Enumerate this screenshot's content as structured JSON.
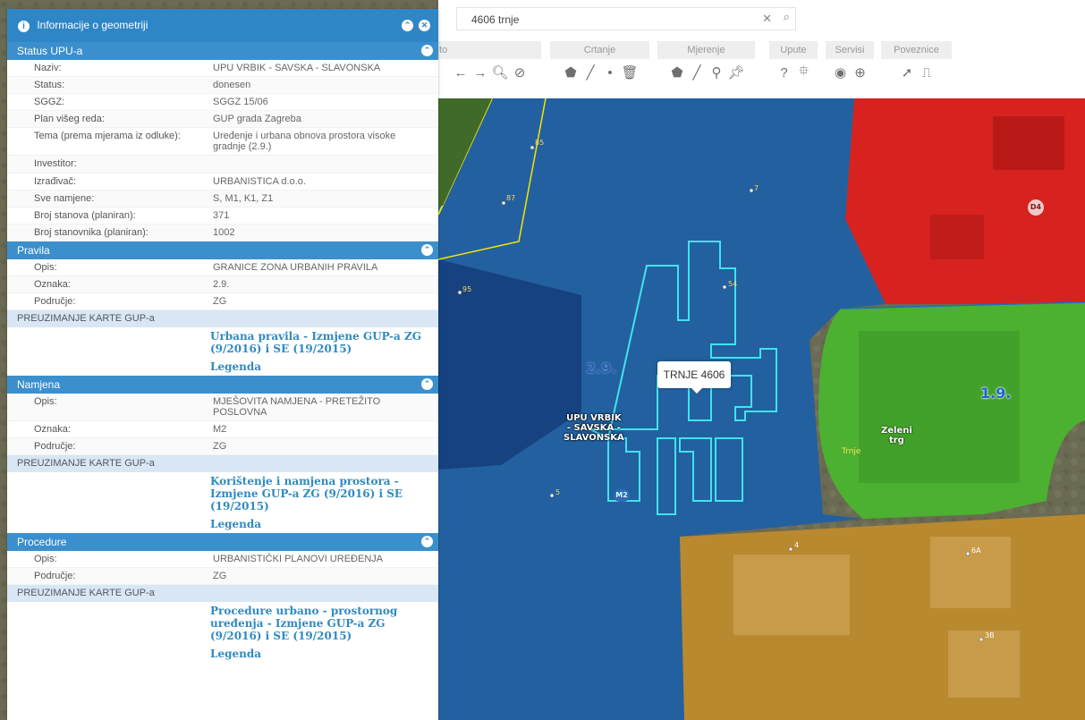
{
  "search": {
    "value": "4606 trnje",
    "clear_glyph": "✕",
    "search_glyph": "⌕"
  },
  "toolbar": {
    "groups": [
      {
        "label": "to",
        "icons": [
          "←",
          "→",
          "🔍︎",
          "⊘"
        ]
      },
      {
        "label": "Crtanje",
        "icons": [
          "⬟",
          "╱",
          "•",
          "🗑︎"
        ]
      },
      {
        "label": "Mjerenje",
        "icons": [
          "⬟",
          "╱",
          "⚲",
          "📌︎"
        ]
      },
      {
        "label": "Upute",
        "icons": [
          "?",
          "⯐"
        ]
      },
      {
        "label": "Servisi",
        "icons": [
          "◉",
          "⊕"
        ]
      },
      {
        "label": "Poveznice",
        "icons": [
          "➚",
          "⎍"
        ]
      }
    ]
  },
  "panel": {
    "title": "Informacije o geometriji",
    "sections": {
      "status": {
        "title": "Status UPU-a",
        "rows": [
          {
            "k": "Naziv:",
            "v": "UPU VRBIK - SAVSKA - SLAVONSKA"
          },
          {
            "k": "Status:",
            "v": "donesen"
          },
          {
            "k": "SGGZ:",
            "v": "SGGZ 15/06"
          },
          {
            "k": "Plan višeg reda:",
            "v": "GUP grada Zagreba"
          },
          {
            "k": "Tema (prema mjerama iz odluke):",
            "v": "Uređenje i urbana obnova prostora visoke gradnje (2.9.)"
          },
          {
            "k": "Investitor:",
            "v": ""
          },
          {
            "k": "Izrađivač:",
            "v": "URBANISTICA d.o.o."
          },
          {
            "k": "Sve namjene:",
            "v": "S, M1, K1, Z1"
          },
          {
            "k": "Broj stanova (planiran):",
            "v": "371"
          },
          {
            "k": "Broj stanovnika (planiran):",
            "v": "1002"
          }
        ]
      },
      "pravila": {
        "title": "Pravila",
        "rows": [
          {
            "k": "Opis:",
            "v": "GRANICE ZONA URBANIH PRAVILA"
          },
          {
            "k": "Oznaka:",
            "v": "2.9."
          },
          {
            "k": "Područje:",
            "v": "ZG"
          }
        ],
        "sub": "PREUZIMANJE KARTE GUP-a",
        "link": "Urbana pravila - Izmjene GUP-a ZG (9/2016) i SE (19/2015)",
        "legend": "Legenda"
      },
      "namjena": {
        "title": "Namjena",
        "rows": [
          {
            "k": "Opis:",
            "v": "MJEŠOVITA NAMJENA - PRETEŽITO POSLOVNA"
          },
          {
            "k": "Oznaka:",
            "v": "M2"
          },
          {
            "k": "Područje:",
            "v": "ZG"
          }
        ],
        "sub": "PREUZIMANJE KARTE GUP-a",
        "link": "Korištenje i namjena prostora - Izmjene GUP-a ZG (9/2016) i SE (19/2015)",
        "legend": "Legenda"
      },
      "procedure": {
        "title": "Procedure",
        "rows": [
          {
            "k": "Opis:",
            "v": "URBANISTIČKI PLANOVI UREĐENJA"
          },
          {
            "k": "Područje:",
            "v": "ZG"
          }
        ],
        "sub": "PREUZIMANJE KARTE GUP-a",
        "link": "Procedure urbano - prostornog uređenja - Izmjene GUP-a ZG (9/2016) i SE (19/2015)",
        "legend": "Legenda"
      }
    }
  },
  "map": {
    "popup": "TRNJE 4606",
    "zone_label_29": "2.9.",
    "zone_label_19": "1.9.",
    "upu_label": [
      "UPU VRBIK",
      "- SAVSKA -",
      "SLAVONSKA"
    ],
    "zeleni_trg": [
      "Zeleni",
      "trg"
    ],
    "trnje": "Trnje",
    "m2_badge": "M2",
    "d4_badge": "D4",
    "pts": [
      "85",
      "87",
      "7",
      "95",
      "54",
      "5",
      "4",
      "6A",
      "3B"
    ]
  }
}
